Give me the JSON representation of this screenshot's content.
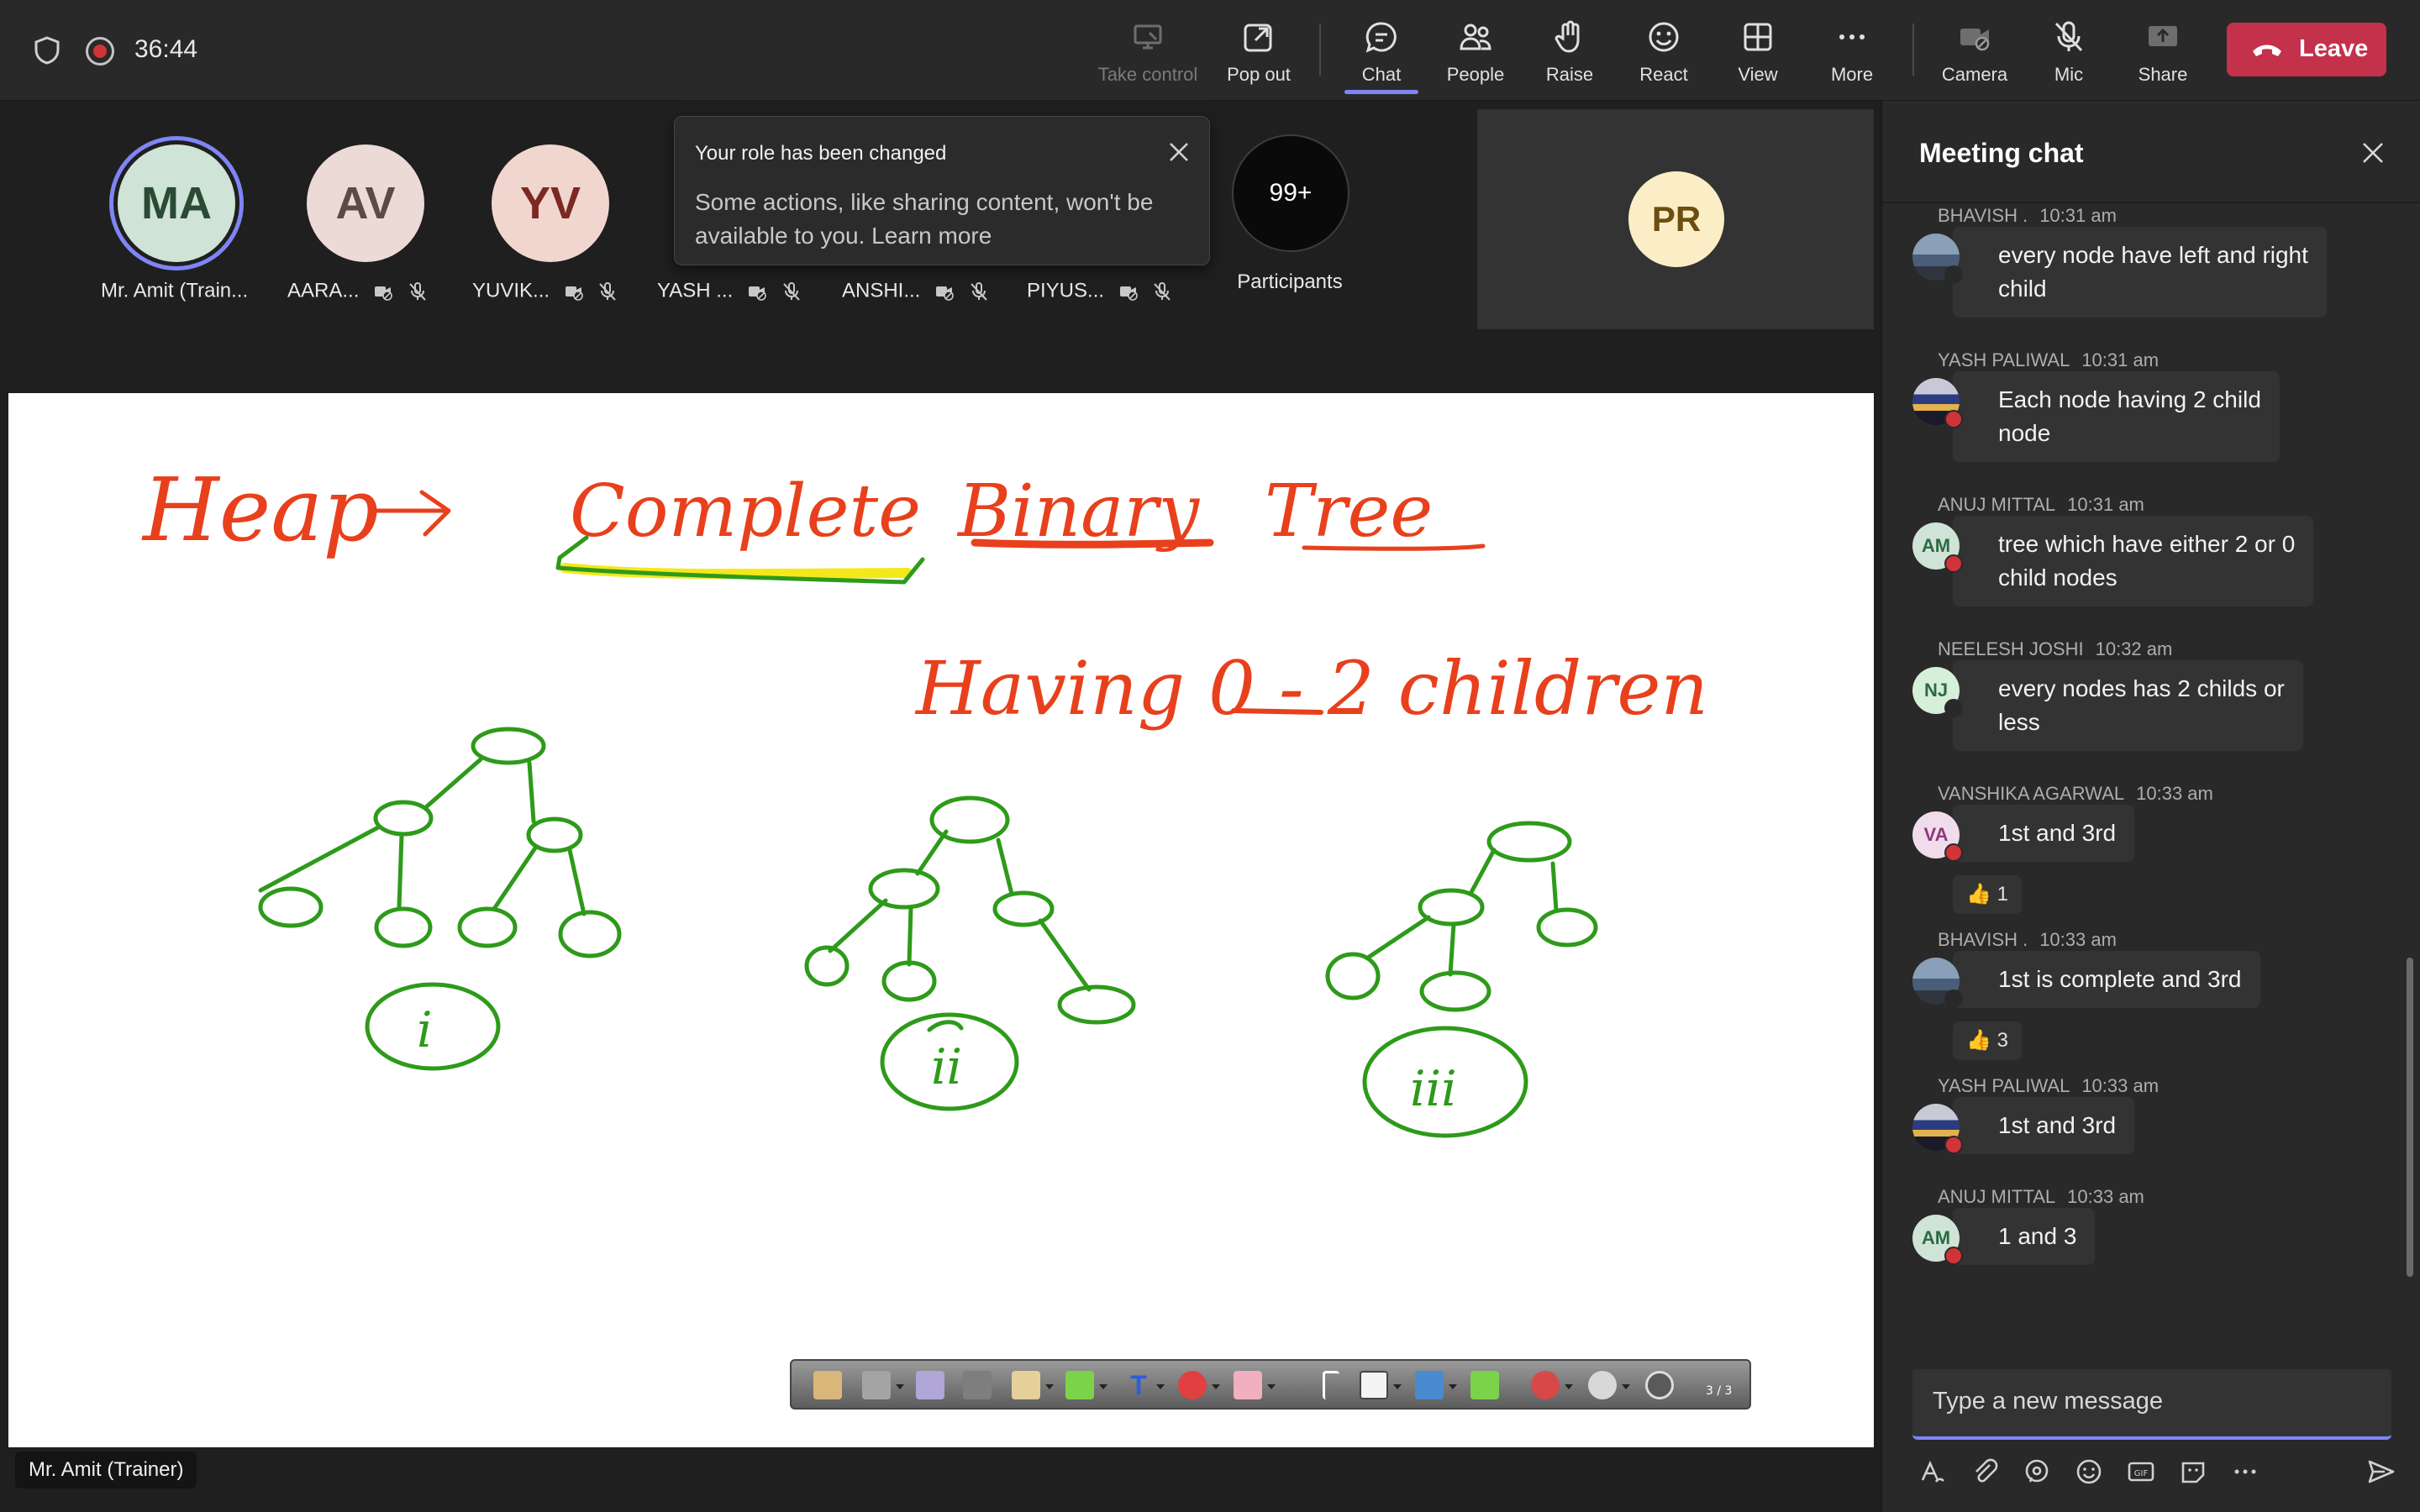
{
  "meeting": {
    "timer": "36:44",
    "presenter_label": "Mr. Amit (Trainer)"
  },
  "toolbar": {
    "take_control": "Take control",
    "pop_out": "Pop out",
    "chat": "Chat",
    "people": "People",
    "raise": "Raise",
    "react": "React",
    "view": "View",
    "more": "More",
    "camera": "Camera",
    "mic": "Mic",
    "share": "Share",
    "leave": "Leave"
  },
  "participants": {
    "items": [
      {
        "initials": "MA",
        "name": "Mr. Amit (Train..."
      },
      {
        "initials": "AV",
        "name": "AARA..."
      },
      {
        "initials": "YV",
        "name": "YUVIK..."
      },
      {
        "name": "YASH ..."
      },
      {
        "name": "ANSHI..."
      },
      {
        "name": "PIYUS..."
      }
    ],
    "overflow_count": "99+",
    "overflow_label": "Participants",
    "pinned_initials": "PR"
  },
  "toast": {
    "title": "Your role has been changed",
    "body": "Some actions, like sharing content, won't be available to you. Learn more"
  },
  "whiteboard": {
    "heading_left": "Heap →",
    "heading_words": [
      "Complete",
      "Binary",
      "Tree"
    ],
    "subnote": "Having 0 - 2 children",
    "tree_labels": [
      "i",
      "ii",
      "iii"
    ],
    "page_indicator": "3 / 3"
  },
  "chat": {
    "title": "Meeting chat",
    "messages": [
      {
        "sender": "BHAVISH .",
        "time": "10:31 am",
        "text_lines": [
          "every node have left and right",
          "child"
        ],
        "avatar": "photo"
      },
      {
        "sender": "YASH PALIWAL",
        "time": "10:31 am",
        "text_lines": [
          "Each node having 2 child",
          "node"
        ],
        "avatar": "sunset"
      },
      {
        "sender": "ANUJ MITTAL",
        "time": "10:31 am",
        "text_lines": [
          "tree which have either 2 or 0",
          "child nodes"
        ],
        "initials": "AM"
      },
      {
        "sender": "NEELESH JOSHI",
        "time": "10:32 am",
        "text_lines": [
          "every nodes has 2 childs or",
          "less"
        ],
        "initials": "NJ"
      },
      {
        "sender": "VANSHIKA AGARWAL",
        "time": "10:33 am",
        "text_lines": [
          "1st and 3rd"
        ],
        "initials": "VA",
        "reaction": "1"
      },
      {
        "sender": "BHAVISH .",
        "time": "10:33 am",
        "text_lines": [
          "1st is complete and 3rd"
        ],
        "avatar": "photo",
        "reaction": "3"
      },
      {
        "sender": "YASH PALIWAL",
        "time": "10:33 am",
        "text_lines": [
          "1st and 3rd"
        ],
        "avatar": "sunset"
      },
      {
        "sender": "ANUJ MITTAL",
        "time": "10:33 am",
        "text_lines": [
          "1 and 3"
        ],
        "initials": "AM"
      }
    ],
    "compose_placeholder": "Type a new message"
  },
  "colors": {
    "accent": "#7f85f5",
    "leave": "#c4314b",
    "ink_red": "#e8401c",
    "ink_green": "#2e9a1a",
    "highlight_yellow": "#f4e81a"
  }
}
